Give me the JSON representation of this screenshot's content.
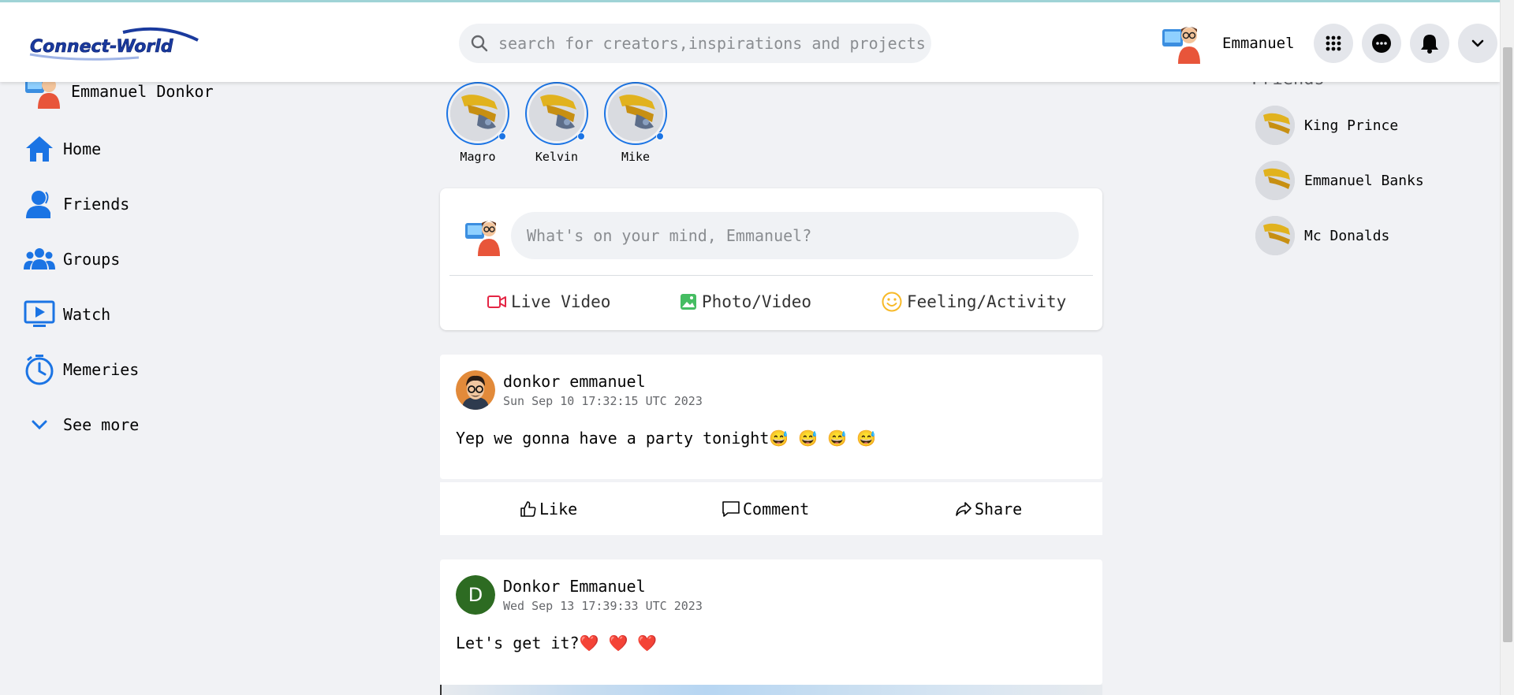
{
  "header": {
    "logo_text": "Connect-World",
    "search_placeholder": "search for creators,inspirations and projects",
    "user_name": "Emmanuel",
    "buttons": [
      "apps-menu",
      "messenger",
      "notifications",
      "account-menu"
    ]
  },
  "sidebar": {
    "profile_name": "Emmanuel Donkor",
    "items": [
      {
        "label": "Home",
        "icon": "home-icon"
      },
      {
        "label": "Friends",
        "icon": "friends-icon"
      },
      {
        "label": "Groups",
        "icon": "groups-icon"
      },
      {
        "label": "Watch",
        "icon": "watch-icon"
      },
      {
        "label": "Memeries",
        "icon": "memories-icon"
      },
      {
        "label": "See more",
        "icon": "chevron-down-icon"
      }
    ]
  },
  "stories": [
    {
      "name": "Magro"
    },
    {
      "name": "Kelvin"
    },
    {
      "name": "Mike"
    }
  ],
  "composer": {
    "placeholder": "What's on your mind, Emmanuel?",
    "actions": [
      {
        "label": "Live Video",
        "icon": "video-camera-icon",
        "color": "#e42645"
      },
      {
        "label": "Photo/Video",
        "icon": "photo-icon",
        "color": "#45bd62"
      },
      {
        "label": "Feeling/Activity",
        "icon": "smiley-icon",
        "color": "#f7b928"
      }
    ]
  },
  "posts": [
    {
      "author": "donkor emmanuel",
      "timestamp": "Sun Sep 10 17:32:15 UTC 2023",
      "text": "Yep we gonna have a party tonight😅 😅 😅 😅",
      "actions": {
        "like": "Like",
        "comment": "Comment",
        "share": "Share"
      }
    },
    {
      "author": "Donkor Emmanuel",
      "avatar_letter": "D",
      "timestamp": "Wed Sep 13 17:39:33 UTC 2023",
      "text": "Let's get it?❤️ ❤️ ❤️"
    }
  ],
  "friends": {
    "title": "Friends",
    "list": [
      {
        "name": "King Prince",
        "status": "online",
        "status_color": "#31a24c"
      },
      {
        "name": "Emmanuel Banks",
        "status": "offline",
        "status_color": "#65676b"
      },
      {
        "name": "Mc Donalds",
        "status": "online",
        "status_color": "#31a24c"
      }
    ]
  },
  "colors": {
    "accent": "#1b74e4",
    "background": "#f1f2f5"
  }
}
